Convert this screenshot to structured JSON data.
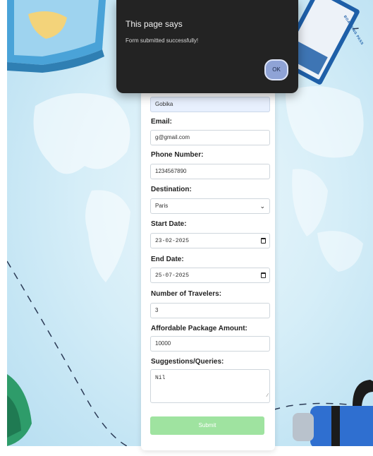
{
  "dialog": {
    "title": "This page says",
    "message": "Form submitted successfully!",
    "ok_label": "OK"
  },
  "form": {
    "name_value": "Gobika",
    "email_label": "Email:",
    "email_value": "g@gmail.com",
    "phone_label": "Phone Number:",
    "phone_value": "1234567890",
    "destination_label": "Destination:",
    "destination_value": "Paris",
    "start_label": "Start Date:",
    "start_value": "23-02-2025",
    "end_label": "End Date:",
    "end_value": "25-07-2025",
    "travelers_label": "Number of Travelers:",
    "travelers_value": "3",
    "amount_label": "Affordable Package Amount:",
    "amount_value": "10000",
    "suggestions_label": "Suggestions/Queries:",
    "suggestions_value": "Nil",
    "submit_label": "Submit"
  },
  "colors": {
    "submit_button": "#9fe3a0",
    "dialog_bg": "#232323",
    "ok_button": "#8fa3d6",
    "background": "#c4e5f4"
  },
  "decor": {
    "boarding_pass_text": "BOARDING PASS"
  }
}
